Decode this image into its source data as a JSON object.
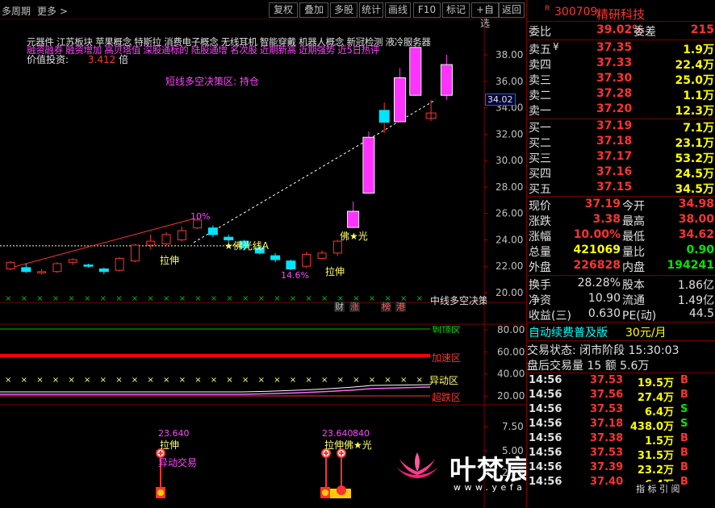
{
  "toolbar": {
    "period": "多周期",
    "more": "更多",
    "buttons": [
      "复权",
      "叠加",
      "多股",
      "统计",
      "画线",
      "F10",
      "标记",
      "+自选",
      "返回"
    ]
  },
  "chart_data": {
    "type": "candlestick",
    "price_axis": {
      "ticks": [
        38.0,
        36.0,
        34.0,
        32.0,
        30.0,
        28.0,
        26.0,
        24.0,
        22.0,
        20.0
      ],
      "current": "34.02"
    },
    "candles": [
      {
        "o": 21.8,
        "c": 22.3,
        "h": 22.4,
        "l": 21.7
      },
      {
        "o": 21.9,
        "c": 21.6,
        "h": 22.2,
        "l": 21.5
      },
      {
        "o": 21.5,
        "c": 21.6,
        "h": 21.8,
        "l": 21.4
      },
      {
        "o": 21.6,
        "c": 22.2,
        "h": 22.3,
        "l": 21.5
      },
      {
        "o": 22.3,
        "c": 22.5,
        "h": 22.6,
        "l": 22.1
      },
      {
        "o": 22.1,
        "c": 22.0,
        "h": 22.2,
        "l": 21.9
      },
      {
        "o": 21.8,
        "c": 21.6,
        "h": 21.9,
        "l": 21.4
      },
      {
        "o": 21.7,
        "c": 22.6,
        "h": 22.7,
        "l": 21.6
      },
      {
        "o": 22.4,
        "c": 23.6,
        "h": 23.7,
        "l": 22.3
      },
      {
        "o": 23.6,
        "c": 23.9,
        "h": 24.4,
        "l": 23.3
      },
      {
        "o": 23.7,
        "c": 24.4,
        "h": 24.6,
        "l": 23.5
      },
      {
        "o": 24.0,
        "c": 24.7,
        "h": 25.0,
        "l": 23.9
      },
      {
        "o": 24.9,
        "c": 25.5,
        "h": 25.7,
        "l": 24.8
      },
      {
        "o": 24.9,
        "c": 24.4,
        "h": 25.1,
        "l": 24.2
      },
      {
        "o": 24.2,
        "c": 24.0,
        "h": 24.4,
        "l": 23.8
      },
      {
        "o": 23.9,
        "c": 23.4,
        "h": 24.0,
        "l": 23.2
      },
      {
        "o": 23.4,
        "c": 23.0,
        "h": 23.6,
        "l": 22.9
      },
      {
        "o": 22.8,
        "c": 22.5,
        "h": 23.0,
        "l": 22.3
      },
      {
        "o": 22.4,
        "c": 21.8,
        "h": 22.5,
        "l": 21.7
      },
      {
        "o": 22.0,
        "c": 22.9,
        "h": 23.1,
        "l": 21.9
      },
      {
        "o": 22.6,
        "c": 23.0,
        "h": 23.2,
        "l": 22.5
      },
      {
        "o": 23.0,
        "c": 23.9,
        "h": 24.0,
        "l": 22.8
      },
      {
        "o": 25.0,
        "c": 26.1,
        "h": 26.9,
        "l": 24.9
      },
      {
        "o": 27.6,
        "c": 31.7,
        "h": 32.2,
        "l": 27.5
      },
      {
        "o": 32.9,
        "c": 33.8,
        "h": 34.4,
        "l": 32.1
      },
      {
        "o": 33.0,
        "c": 36.2,
        "h": 37.0,
        "l": 32.9
      },
      {
        "o": 38.5,
        "c": 35.0,
        "h": 38.9,
        "l": 34.9
      },
      {
        "o": 33.2,
        "c": 33.6,
        "h": 34.6,
        "l": 33.0
      },
      {
        "o": 35.0,
        "c": 37.2,
        "h": 38.0,
        "l": 34.6
      }
    ],
    "mid_axis": {
      "ticks": [
        80.0,
        60.0,
        40.0,
        20.0
      ]
    },
    "bottom_axis": {
      "ticks": [
        "7.50",
        "5.00",
        "2.50"
      ]
    }
  },
  "annotations": {
    "concepts_line1": "元器件 江苏板块 苹果概念 特斯拉 消费电子概念 无线耳机 智能穿戴 机器人概念 新冠检测 液冷服务器",
    "concepts_line2": "融资融券 融资增加 高贝塔值 深股通标的 陆股通增 名次股 近期新高 近期强势 近5日热评",
    "value_label": "价值投资:",
    "value_number": "3.412",
    "value_unit": "倍",
    "strategy": "短线多空决策区: 持仓",
    "pct10": "10%",
    "foguang_a": "★佛光线A",
    "lashen1": "拉伸",
    "lashen2": "拉伸",
    "pct14": "14.6%",
    "foguang": "佛★光",
    "midline": "中线多空决策",
    "tags": [
      "财",
      "涨",
      "榜",
      "港"
    ],
    "zone1": "到顶区",
    "zone2": "加速区",
    "zone3": "异动区",
    "zone4": "超跌区",
    "b_val1": "23.640",
    "b_lashen1": "拉伸",
    "b_yidong": "异动交易",
    "b_val2": "23.640",
    "b_val3": "840",
    "b_lashen2": "拉伸",
    "b_foguang": "佛★光",
    "watermark_cn": "叶梵宸指标公式网",
    "watermark_url": "www.yefanchen.com"
  },
  "quote": {
    "code": "300709",
    "name": "精研科技",
    "weibi_label": "委比",
    "weibi": "39.02%",
    "weicha_label": "委差",
    "weicha": "215",
    "asks": [
      {
        "label": "卖五",
        "flag": "¥",
        "price": "37.35",
        "vol": "1.9万"
      },
      {
        "label": "卖四",
        "flag": "",
        "price": "37.33",
        "vol": "22.4万"
      },
      {
        "label": "卖三",
        "flag": "",
        "price": "37.30",
        "vol": "25.0万"
      },
      {
        "label": "卖二",
        "flag": "",
        "price": "37.28",
        "vol": "1.1万"
      },
      {
        "label": "卖一",
        "flag": "",
        "price": "37.20",
        "vol": "12.3万"
      }
    ],
    "bids": [
      {
        "label": "买一",
        "price": "37.19",
        "vol": "7.1万"
      },
      {
        "label": "买二",
        "price": "37.18",
        "vol": "23.1万"
      },
      {
        "label": "买三",
        "price": "37.17",
        "vol": "53.2万"
      },
      {
        "label": "买四",
        "price": "37.16",
        "vol": "24.5万"
      },
      {
        "label": "买五",
        "price": "37.15",
        "vol": "34.5万"
      }
    ],
    "stats1": [
      {
        "l1": "现价",
        "v1": "37.19",
        "c1": "red",
        "l2": "今开",
        "v2": "34.98",
        "c2": "red"
      },
      {
        "l1": "涨跌",
        "v1": "3.38",
        "c1": "red",
        "l2": "最高",
        "v2": "38.00",
        "c2": "red"
      },
      {
        "l1": "涨幅",
        "v1": "10.00%",
        "c1": "red",
        "l2": "最低",
        "v2": "34.62",
        "c2": "red"
      },
      {
        "l1": "总量",
        "v1": "421069",
        "c1": "yel",
        "l2": "量比",
        "v2": "0.90",
        "c2": "grn"
      },
      {
        "l1": "外盘",
        "v1": "226828",
        "c1": "red",
        "l2": "内盘",
        "v2": "194241",
        "c2": "grn"
      }
    ],
    "stats2": [
      {
        "l1": "换手",
        "v1": "28.28%",
        "l2": "股本",
        "v2": "1.86亿"
      },
      {
        "l1": "净资",
        "v1": "10.90",
        "l2": "流通",
        "v2": "1.49亿"
      },
      {
        "l1": "收益(三)",
        "v1": "0.630",
        "l2": "PE(动)",
        "v2": "44.5"
      }
    ],
    "ad_text": "自动续费普及版",
    "ad_price": "30元/月",
    "trade_status": "交易状态: 闭市阶段 15:30:03",
    "after_hours": "盘后交易量 15 额 5.6万",
    "ticks": [
      {
        "t": "14:56",
        "p": "37.53",
        "v": "19.5万",
        "s": "B"
      },
      {
        "t": "14:56",
        "p": "37.56",
        "v": "27.4万",
        "s": "B"
      },
      {
        "t": "14:56",
        "p": "37.53",
        "v": "6.4万",
        "s": "S"
      },
      {
        "t": "14:56",
        "p": "37.18",
        "v": "438.0万",
        "s": "S"
      },
      {
        "t": "14:56",
        "p": "37.38",
        "v": "1.5万",
        "s": "B"
      },
      {
        "t": "14:56",
        "p": "37.53",
        "v": "31.5万",
        "s": "B"
      },
      {
        "t": "14:56",
        "p": "37.39",
        "v": "23.2万",
        "s": "B"
      },
      {
        "t": "14:56",
        "p": "37.40",
        "v": "6.4万",
        "s": "B"
      }
    ],
    "bottom_tabs": "指  标  引  阅"
  }
}
